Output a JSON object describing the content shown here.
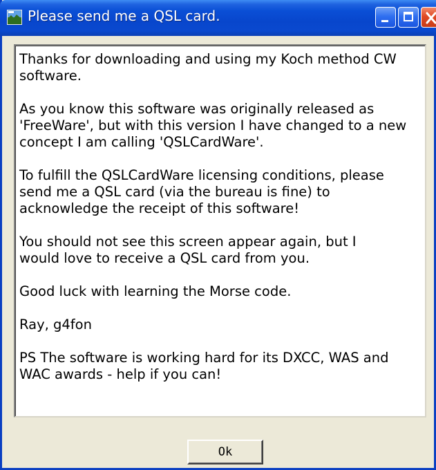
{
  "window": {
    "title": "Please send me a QSL card.",
    "icon": "app-icon",
    "controls": [
      "minimize-icon",
      "maximize-icon",
      "close-icon"
    ],
    "colors": {
      "titlebar": "#0a4fd6",
      "close_button": "#df4a24",
      "dialog_background": "#ece9d8"
    }
  },
  "message": {
    "paragraphs": [
      "Thanks for downloading and using my Koch method CW\nsoftware.",
      "As you know this software was originally released as\n'FreeWare', but with this version I have changed to a new\nconcept I am calling 'QSLCardWare'.",
      "To fulfill the QSLCardWare licensing conditions, please\nsend me a QSL card (via the bureau is fine) to\nacknowledge the receipt of this software!",
      "You should not see this screen appear again, but I\nwould love to receive a QSL card from you.",
      "Good luck with learning the Morse code.",
      "Ray, g4fon",
      "PS The software is working hard for its DXCC, WAS and\nWAC awards - help if you can!"
    ]
  },
  "buttons": {
    "ok_label": "Ok"
  }
}
